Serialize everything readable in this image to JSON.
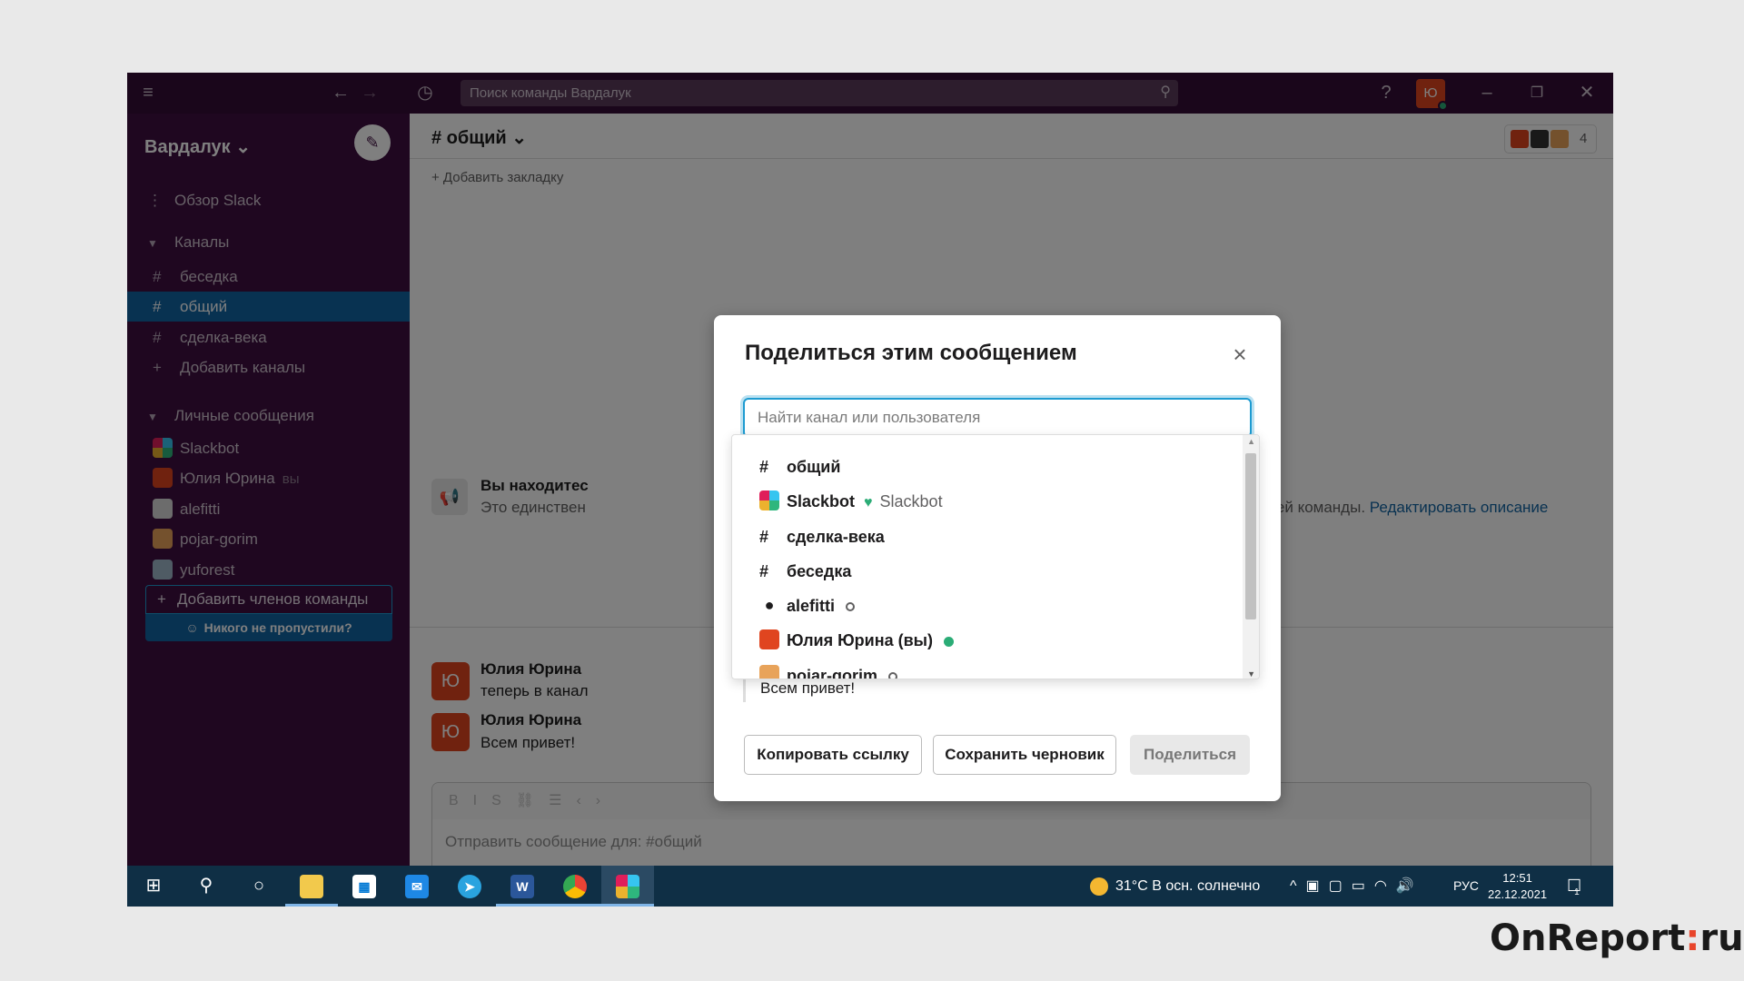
{
  "titlebar": {
    "search_placeholder": "Поиск команды Вардалук",
    "avatar_letter": "Ю"
  },
  "sidebar": {
    "workspace": "Вардалук ⌄",
    "overview": "Обзор Slack",
    "channels_header": "Каналы",
    "channels": [
      {
        "label": "беседка"
      },
      {
        "label": "общий"
      },
      {
        "label": "сделка-века"
      }
    ],
    "add_channels": "Добавить каналы",
    "dm_header": "Личные сообщения",
    "dms": [
      {
        "label": "Slackbot"
      },
      {
        "label": "Юлия Юрина",
        "suffix": "вы"
      },
      {
        "label": "alefitti"
      },
      {
        "label": "pojar-gorim"
      },
      {
        "label": "yuforest"
      }
    ],
    "add_members": "Добавить членов команды",
    "nobody_missed": "Никого не пропустили?"
  },
  "main": {
    "channel_title": "# общий ⌄",
    "member_count": "4",
    "bookmark": "+ Добавить закладку",
    "intro_title": "Вы находитес",
    "intro_text": "Это единствен",
    "intro_tail": "д, касающихся всей команды.",
    "intro_link": "Редактировать описание",
    "messages": [
      {
        "avatar": "Ю",
        "name": "Юлия Юрина",
        "text": "теперь в канал"
      },
      {
        "avatar": "Ю",
        "name": "Юлия Юрина",
        "text": "Всем привет!"
      }
    ],
    "composer_placeholder": "Отправить сообщение для: #общий"
  },
  "dialog": {
    "title": "Поделиться этим сообщением",
    "search_placeholder": "Найти канал или пользователя",
    "message_preview": "Всем привет!",
    "copy_link": "Копировать ссылку",
    "save_draft": "Сохранить черновик",
    "share": "Поделиться",
    "options": [
      {
        "name": "общий"
      },
      {
        "name": "Slackbot",
        "sub": "Slackbot"
      },
      {
        "name": "сделка-века"
      },
      {
        "name": "беседка"
      },
      {
        "name": "alefitti"
      },
      {
        "name": "Юлия Юрина (вы)"
      },
      {
        "name": "pojar-gorim"
      }
    ]
  },
  "taskbar": {
    "weather": "31°C  В осн. солнечно",
    "lang": "РУС",
    "time": "12:51",
    "date": "22.12.2021",
    "notification_count": "1"
  },
  "watermark": {
    "brand": "OnReport",
    "separator": ":",
    "tld": "ru"
  },
  "colors": {
    "sidebar": "#3f0e40",
    "titlebar": "#350d36",
    "active_channel": "#1164a3",
    "avatar": "#e0451f",
    "online": "#2bac76",
    "taskbar": "#0f2f45"
  }
}
